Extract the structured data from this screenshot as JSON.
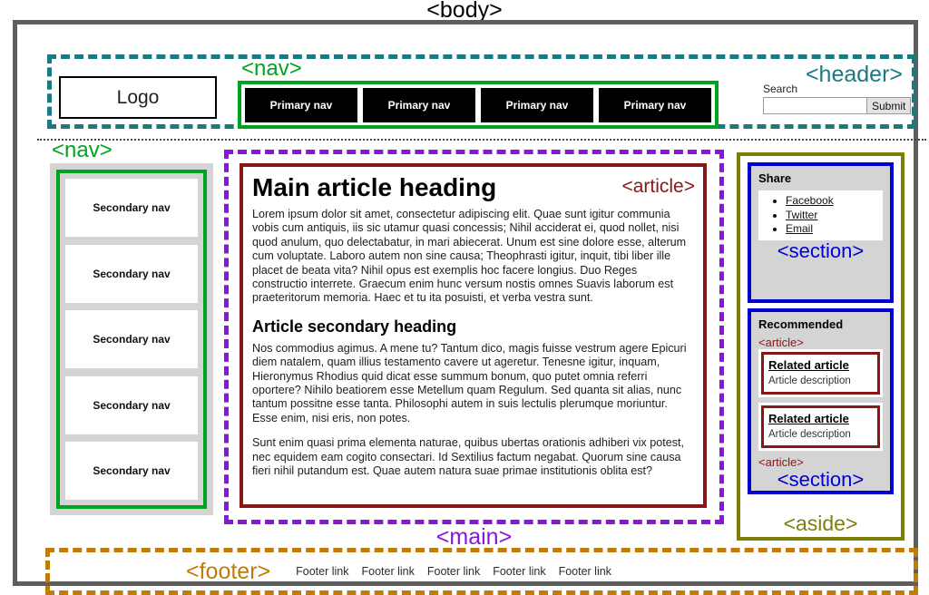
{
  "diagram": {
    "body_tag": "<body>"
  },
  "header": {
    "tag": "<header>",
    "logo": "Logo",
    "nav": {
      "tag": "<nav>",
      "items": [
        {
          "label": "Primary nav"
        },
        {
          "label": "Primary nav"
        },
        {
          "label": "Primary nav"
        },
        {
          "label": "Primary nav"
        }
      ]
    },
    "search": {
      "label": "Search",
      "value": "",
      "placeholder": "",
      "submit_label": "Submit"
    }
  },
  "secondary_nav": {
    "tag": "<nav>",
    "items": [
      {
        "label": "Secondary nav"
      },
      {
        "label": "Secondary nav"
      },
      {
        "label": "Secondary nav"
      },
      {
        "label": "Secondary nav"
      },
      {
        "label": "Secondary nav"
      }
    ]
  },
  "main": {
    "tag": "<main>",
    "article": {
      "tag": "<article>",
      "heading": "Main article heading",
      "paragraph_1": "Lorem ipsum dolor sit amet, consectetur adipiscing elit. Quae sunt igitur communia vobis cum antiquis, iis sic utamur quasi concessis; Nihil acciderat ei, quod nollet, nisi quod anulum, quo delectabatur, in mari abiecerat. Unum est sine dolore esse, alterum cum voluptate. Laboro autem non sine causa; Theophrasti igitur, inquit, tibi liber ille placet de beata vita? Nihil opus est exemplis hoc facere longius. Duo Reges constructio interrete. Graecum enim hunc versum nostis omnes Suavis laborum est praeteritorum memoria. Haec et tu ita posuisti, et verba vestra sunt.",
      "secondary_heading": "Article secondary heading",
      "paragraph_2": "Nos commodius agimus. A mene tu? Tantum dico, magis fuisse vestrum agere Epicuri diem natalem, quam illius testamento cavere ut ageretur. Tenesne igitur, inquam, Hieronymus Rhodius quid dicat esse summum bonum, quo putet omnia referri oportere? Nihilo beatiorem esse Metellum quam Regulum. Sed quanta sit alias, nunc tantum possitne esse tanta. Philosophi autem in suis lectulis plerumque moriuntur. Esse enim, nisi eris, non potes.",
      "paragraph_3": "Sunt enim quasi prima elementa naturae, quibus ubertas orationis adhiberi vix potest, nec equidem eam cogito consectari. Id Sextilius factum negabat. Quorum sine causa fieri nihil putandum est. Quae autem natura suae primae institutionis oblita est?"
    }
  },
  "aside": {
    "tag": "<aside>",
    "share_section": {
      "tag": "<section>",
      "title": "Share",
      "links": [
        {
          "label": "Facebook"
        },
        {
          "label": "Twitter"
        },
        {
          "label": "Email"
        }
      ]
    },
    "recommended_section": {
      "tag": "<section>",
      "title": "Recommended",
      "article_tag_top": "<article>",
      "article_tag_bottom": "<article>",
      "articles": [
        {
          "title": "Related article",
          "description": "Article description"
        },
        {
          "title": "Related article",
          "description": "Article description"
        }
      ]
    }
  },
  "footer": {
    "tag": "<footer>",
    "links": [
      {
        "label": "Footer link"
      },
      {
        "label": "Footer link"
      },
      {
        "label": "Footer link"
      },
      {
        "label": "Footer link"
      },
      {
        "label": "Footer link"
      }
    ]
  },
  "colors": {
    "body_border": "#5e5e5e",
    "header": "#1a7a82",
    "nav": "#00a321",
    "main": "#8b14dd",
    "article": "#8b1616",
    "aside": "#7d8008",
    "section": "#0000d4",
    "footer": "#c07c06"
  }
}
